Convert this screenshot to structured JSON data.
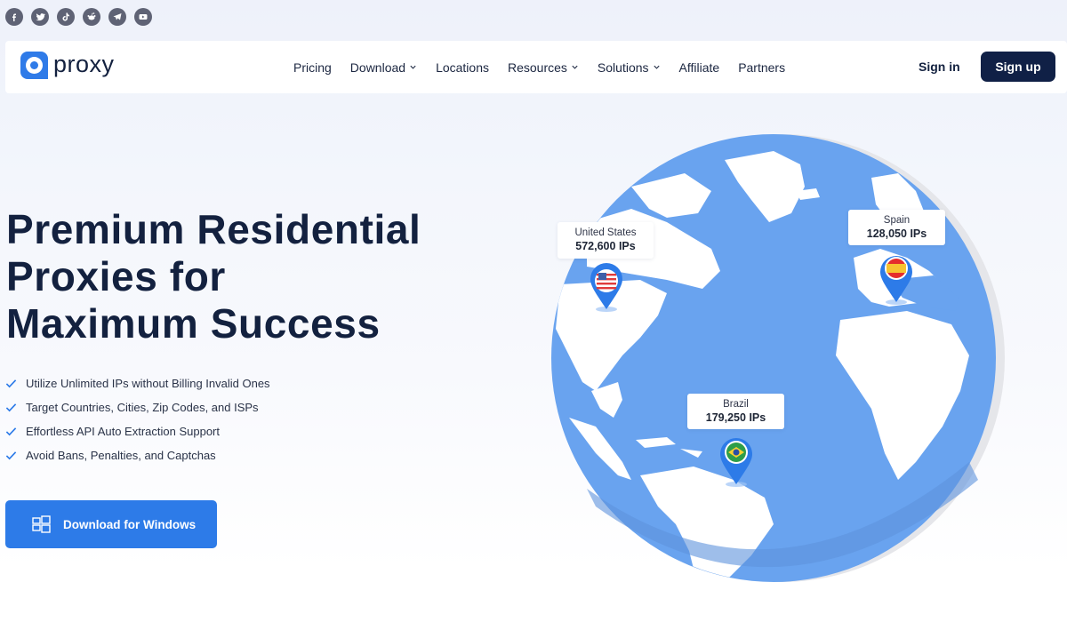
{
  "social": [
    {
      "name": "facebook",
      "icon": "facebook-icon"
    },
    {
      "name": "twitter",
      "icon": "twitter-icon"
    },
    {
      "name": "tiktok",
      "icon": "tiktok-icon"
    },
    {
      "name": "reddit",
      "icon": "reddit-icon"
    },
    {
      "name": "telegram",
      "icon": "telegram-icon"
    },
    {
      "name": "youtube",
      "icon": "youtube-icon"
    }
  ],
  "brand": {
    "name": "proxy",
    "color": "#2f7be8"
  },
  "nav": {
    "items": [
      {
        "label": "Pricing",
        "dropdown": false
      },
      {
        "label": "Download",
        "dropdown": true
      },
      {
        "label": "Locations",
        "dropdown": false
      },
      {
        "label": "Resources",
        "dropdown": true
      },
      {
        "label": "Solutions",
        "dropdown": true
      },
      {
        "label": "Affiliate",
        "dropdown": false
      },
      {
        "label": "Partners",
        "dropdown": false
      }
    ],
    "sign_in": "Sign in",
    "sign_up": "Sign up"
  },
  "hero": {
    "title_lines": [
      "Premium Residential",
      "Proxies for",
      "Maximum Success"
    ],
    "features": [
      "Utilize Unlimited IPs without Billing Invalid Ones",
      "Target Countries, Cities, Zip Codes, and ISPs",
      "Effortless API Auto Extraction Support",
      "Avoid Bans, Penalties, and Captchas"
    ],
    "cta": "Download for Windows"
  },
  "globe": {
    "locations": [
      {
        "country": "United States",
        "ips": "572,600 IPs",
        "flag": "us-flag-icon"
      },
      {
        "country": "Spain",
        "ips": "128,050 IPs",
        "flag": "spain-flag-icon"
      },
      {
        "country": "Brazil",
        "ips": "179,250 IPs",
        "flag": "brazil-flag-icon"
      }
    ]
  },
  "colors": {
    "primary_dark": "#102046",
    "accent_blue": "#2d7be8",
    "globe_ocean": "#69a3ef",
    "text_dark": "#13213f"
  }
}
